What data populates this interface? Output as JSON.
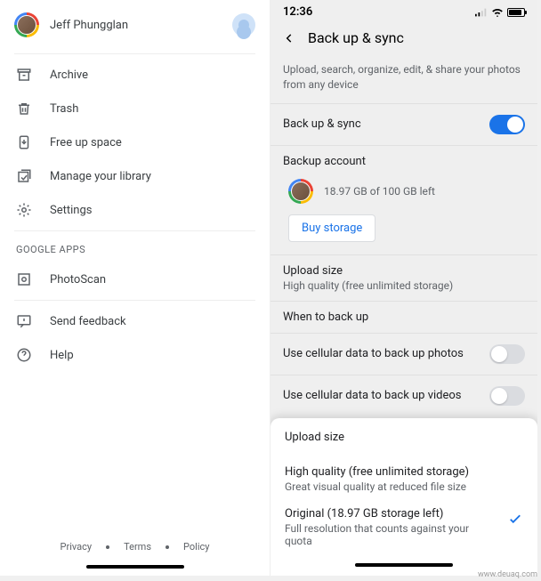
{
  "left": {
    "profile_name": "Jeff Phungglan",
    "menu": {
      "archive": "Archive",
      "trash": "Trash",
      "free_up": "Free up space",
      "manage_library": "Manage your library",
      "settings": "Settings"
    },
    "section_label": "GOOGLE APPS",
    "apps": {
      "photoscan": "PhotoScan"
    },
    "support": {
      "feedback": "Send feedback",
      "help": "Help"
    },
    "footer": {
      "privacy": "Privacy",
      "terms": "Terms",
      "policy": "Policy"
    }
  },
  "right": {
    "status": {
      "time": "12:36"
    },
    "title": "Back up & sync",
    "description": "Upload, search, organize, edit, & share your photos from any device",
    "backup_sync_label": "Back up & sync",
    "backup_sync_on": true,
    "backup_account_label": "Backup account",
    "storage_text": "18.97 GB of 100 GB left",
    "buy_storage": "Buy storage",
    "upload_size": {
      "label": "Upload size",
      "value": "High quality (free unlimited storage)"
    },
    "when_label": "When to back up",
    "cellular_photos_label": "Use cellular data to back up photos",
    "cellular_photos_on": false,
    "cellular_videos_label": "Use cellular data to back up videos",
    "cellular_videos_on": false
  },
  "sheet": {
    "title": "Upload size",
    "opt1": {
      "line1": "High quality (free unlimited storage)",
      "line2": "Great visual quality at reduced file size"
    },
    "opt2": {
      "line1": "Original (18.97 GB storage left)",
      "line2": "Full resolution that counts against your quota",
      "selected": true
    }
  },
  "watermark": "www.deuaq.com"
}
